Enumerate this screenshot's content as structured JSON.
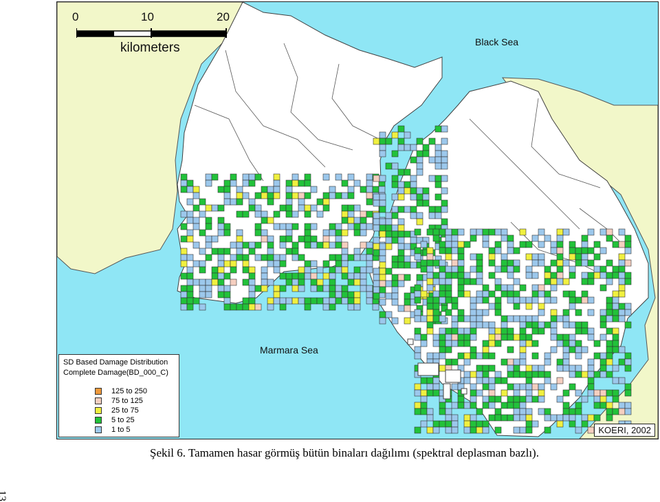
{
  "map": {
    "scale": {
      "ticks": [
        "0",
        "10",
        "20"
      ],
      "unit": "kilometers"
    },
    "sea_labels": {
      "black_sea": "Black Sea",
      "marmara_sea": "Marmara Sea"
    },
    "credit": "KOERI, 2002",
    "colors": {
      "sea": "#8fe6f5",
      "land_outside": "#f2f7c9",
      "district": "#ffffff",
      "border": "#404040"
    }
  },
  "legend": {
    "title_line1": "SD Based Damage Distribution",
    "title_line2": "Complete Damage(BD_000_C)",
    "classes": [
      {
        "label": "125 to 250",
        "color": "#f09a3c"
      },
      {
        "label": "75 to 125",
        "color": "#f5cfc0"
      },
      {
        "label": "25 to  75",
        "color": "#f0f040"
      },
      {
        "label": "5 to  25",
        "color": "#22c23a"
      },
      {
        "label": "1 to    5",
        "color": "#9cc8ec"
      }
    ]
  },
  "caption": "Şekil 6. Tamamen hasar görmüş bütün binaları dağılımı (spektral deplasman bazlı).",
  "page_number": "13"
}
